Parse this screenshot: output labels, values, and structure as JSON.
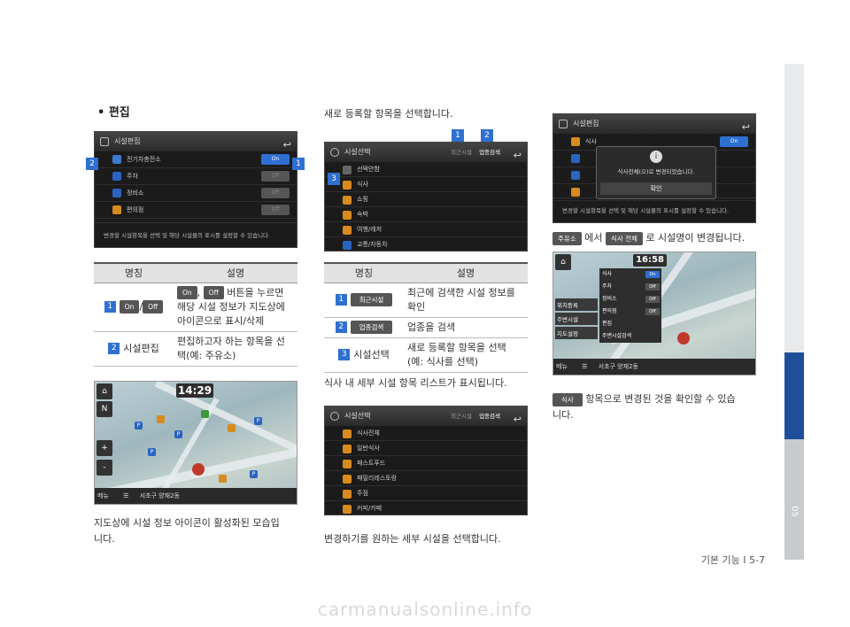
{
  "section_number": "05",
  "page_footer": "기본 기능 I 5-7",
  "watermark": "carmanualsonline.info",
  "col1": {
    "bullet": "• 편집",
    "screen1": {
      "title": "시설편집",
      "rows": [
        {
          "label": "전기차충전소",
          "state": "On"
        },
        {
          "label": "주차",
          "state": "Off"
        },
        {
          "label": "정비소",
          "state": "Off"
        },
        {
          "label": "편의점",
          "state": "Off"
        }
      ],
      "footer": "변경할 시설항목을 선택 및 해당 시설물의 표시를 설정할 수 있습니다.",
      "callouts": [
        "2",
        "1"
      ]
    },
    "table": {
      "headers": [
        "명칭",
        "설명"
      ],
      "row1": {
        "num": "1",
        "chip_on": "On",
        "chip_off": "Off",
        "chip_sep": "/",
        "desc_comma": ",",
        "desc_line1": "버튼을 누르면",
        "desc_line2": "해당 시설 정보가 지도상에",
        "desc_line3": "아이콘으로 표시/삭제"
      },
      "row2": {
        "num": "2",
        "name": "시설편집",
        "desc_line1": "편집하고자 하는 항목을 선",
        "desc_line2": "택(예: 주유소)"
      }
    },
    "map": {
      "clock": "14:29",
      "left_buttons": [
        "N",
        "+",
        "-"
      ],
      "bottom_menu": "메뉴",
      "address": "서초구 양재2동"
    },
    "caption_line1": "지도상에 시설 정보 아이콘이 활성화된 모습입",
    "caption_line2": "니다."
  },
  "col2": {
    "intro": "새로 등록할 항목을 선택합니다.",
    "screen2": {
      "title": "시설선택",
      "tab_recent": "최근시설",
      "tab_industry": "업종검색",
      "rows": [
        "선택안함",
        "식사",
        "쇼핑",
        "숙박",
        "여행/레저",
        "교통/자동차"
      ],
      "callouts": [
        "1",
        "2",
        "3"
      ]
    },
    "table": {
      "headers": [
        "명칭",
        "설명"
      ],
      "row1": {
        "num": "1",
        "chip": "최근시설",
        "desc_line1": "최근에 검색한 시설 정보를",
        "desc_line2": "확인"
      },
      "row2": {
        "num": "2",
        "chip": "업종검색",
        "desc": "업종을 검색"
      },
      "row3": {
        "num": "3",
        "name": "시설선택",
        "desc_line1": "새로 등록할 항목을 선택",
        "desc_line2": "(예: 식사를 선택)"
      }
    },
    "mid_text": "식사 내 세부 시설 항목 리스트가 표시됩니다.",
    "screen3": {
      "title": "시설선택",
      "tab_recent": "최근시설",
      "tab_industry": "업종검색",
      "rows": [
        "식사전체",
        "일반식사",
        "패스트푸드",
        "패밀리레스토랑",
        "주점",
        "커피/카페"
      ]
    },
    "caption": "변경하기를 원하는 세부 시설을 선택합니다."
  },
  "col3": {
    "screen4": {
      "title": "시설편집",
      "row_top": "식사",
      "toggle_top": "On",
      "dialog_text": "식사전체(으)로 변경되었습니다.",
      "dialog_button": "확인",
      "footer": "변경할 시설항목을 선택 및 해당 시설물의 표시를 설정할 수 있습니다."
    },
    "line1": {
      "chip1": "주유소",
      "mid": "에서",
      "chip2": "식사 전체",
      "tail": "로 시설명이 변경됩니다."
    },
    "map2": {
      "clock": "16:58",
      "menu_left": [
        "위치등록",
        "주변시설",
        "지도설정"
      ],
      "menu_right": [
        "식사",
        "주차",
        "정비소",
        "편의점",
        "편집",
        "주변시설검색"
      ],
      "toggles": [
        "On",
        "Off",
        "Off",
        "Off"
      ],
      "bottom_menu": "메뉴",
      "address": "서초구 양재2동"
    },
    "line2": {
      "chip": "식사",
      "text": "항목으로 변경된 것을 확인할 수 있습"
    },
    "line2b": "니다."
  },
  "colors": {
    "accent": "#2f6fd1",
    "sidebar_band": "#1f4f99"
  }
}
